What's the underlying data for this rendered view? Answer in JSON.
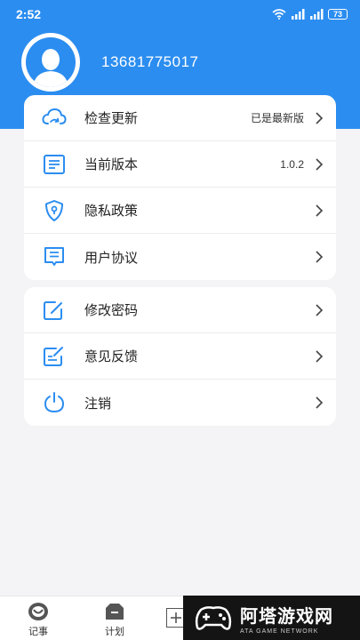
{
  "status": {
    "time": "2:52",
    "battery": "73"
  },
  "profile": {
    "phone": "13681775017"
  },
  "menu_group_1": [
    {
      "label": "检查更新",
      "value": "已是最新版",
      "icon": "cloud-sync-icon"
    },
    {
      "label": "当前版本",
      "value": "1.0.2",
      "icon": "document-list-icon"
    },
    {
      "label": "隐私政策",
      "value": "",
      "icon": "shield-key-icon"
    },
    {
      "label": "用户协议",
      "value": "",
      "icon": "agreement-doc-icon"
    }
  ],
  "menu_group_2": [
    {
      "label": "修改密码",
      "value": "",
      "icon": "edit-square-icon"
    },
    {
      "label": "意见反馈",
      "value": "",
      "icon": "feedback-edit-icon"
    },
    {
      "label": "注销",
      "value": "",
      "icon": "power-icon"
    }
  ],
  "tabbar": {
    "tab1": "记事",
    "tab2": "计划"
  },
  "watermark": {
    "title": "阿塔游戏网",
    "subtitle": "ATA GAME NETWORK"
  },
  "colors": {
    "primary": "#2b8df0",
    "background": "#f4f4f6"
  }
}
